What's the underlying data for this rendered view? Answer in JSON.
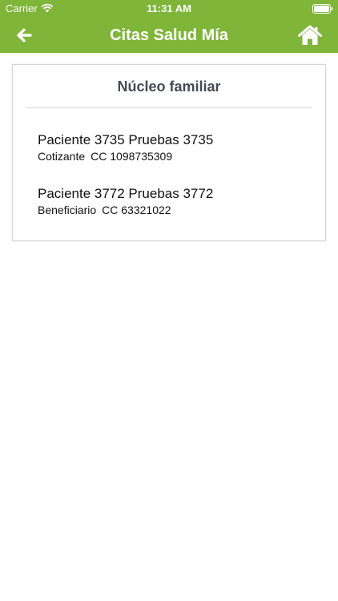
{
  "status_bar": {
    "carrier": "Carrier",
    "time": "11:31 AM",
    "wifi_icon": "wifi-icon",
    "battery_icon": "battery-icon"
  },
  "navbar": {
    "title": "Citas Salud Mía",
    "back_icon": "arrow-left-icon",
    "home_icon": "home-icon",
    "color": "#7fb539"
  },
  "card": {
    "title": "Núcleo familiar",
    "members": [
      {
        "name": "Paciente 3735 Pruebas 3735",
        "role": "Cotizante",
        "document": "CC 1098735309"
      },
      {
        "name": "Paciente 3772 Pruebas 3772",
        "role": "Beneficiario",
        "document": "CC 63321022"
      }
    ]
  }
}
